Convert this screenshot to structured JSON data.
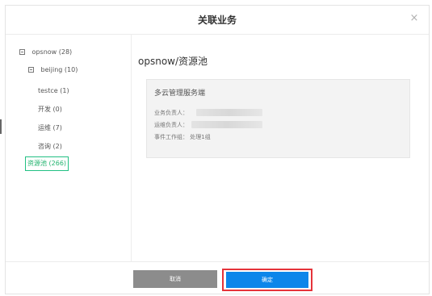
{
  "dialog": {
    "title": "关联业务",
    "close_glyph": "×"
  },
  "tree": {
    "items": [
      {
        "label": "opsnow (28)",
        "icon": "collapse-square-icon"
      },
      {
        "label": "beijing (10)",
        "icon": "collapse-square-icon"
      },
      {
        "label": "testce (1)"
      },
      {
        "label": "开发 (0)"
      },
      {
        "label": "运维 (7)"
      },
      {
        "label": "咨询 (2)"
      },
      {
        "label": "资源池 (266)",
        "selected": true
      }
    ]
  },
  "detail": {
    "path": "opsnow/资源池",
    "card": {
      "title": "多云管理服务端",
      "business_owner_label": "业务负责人：",
      "ops_owner_label": "运维负责人：",
      "incident_group_label": "事件工作组：",
      "incident_group_value": "处理1组"
    }
  },
  "footer": {
    "cancel_label": "取消",
    "confirm_label": "确定"
  },
  "colors": {
    "selected_green": "#22b36e",
    "confirm_blue": "#0d86ea",
    "highlight_red": "#e5333a",
    "cancel_gray": "#8c8c8c"
  }
}
